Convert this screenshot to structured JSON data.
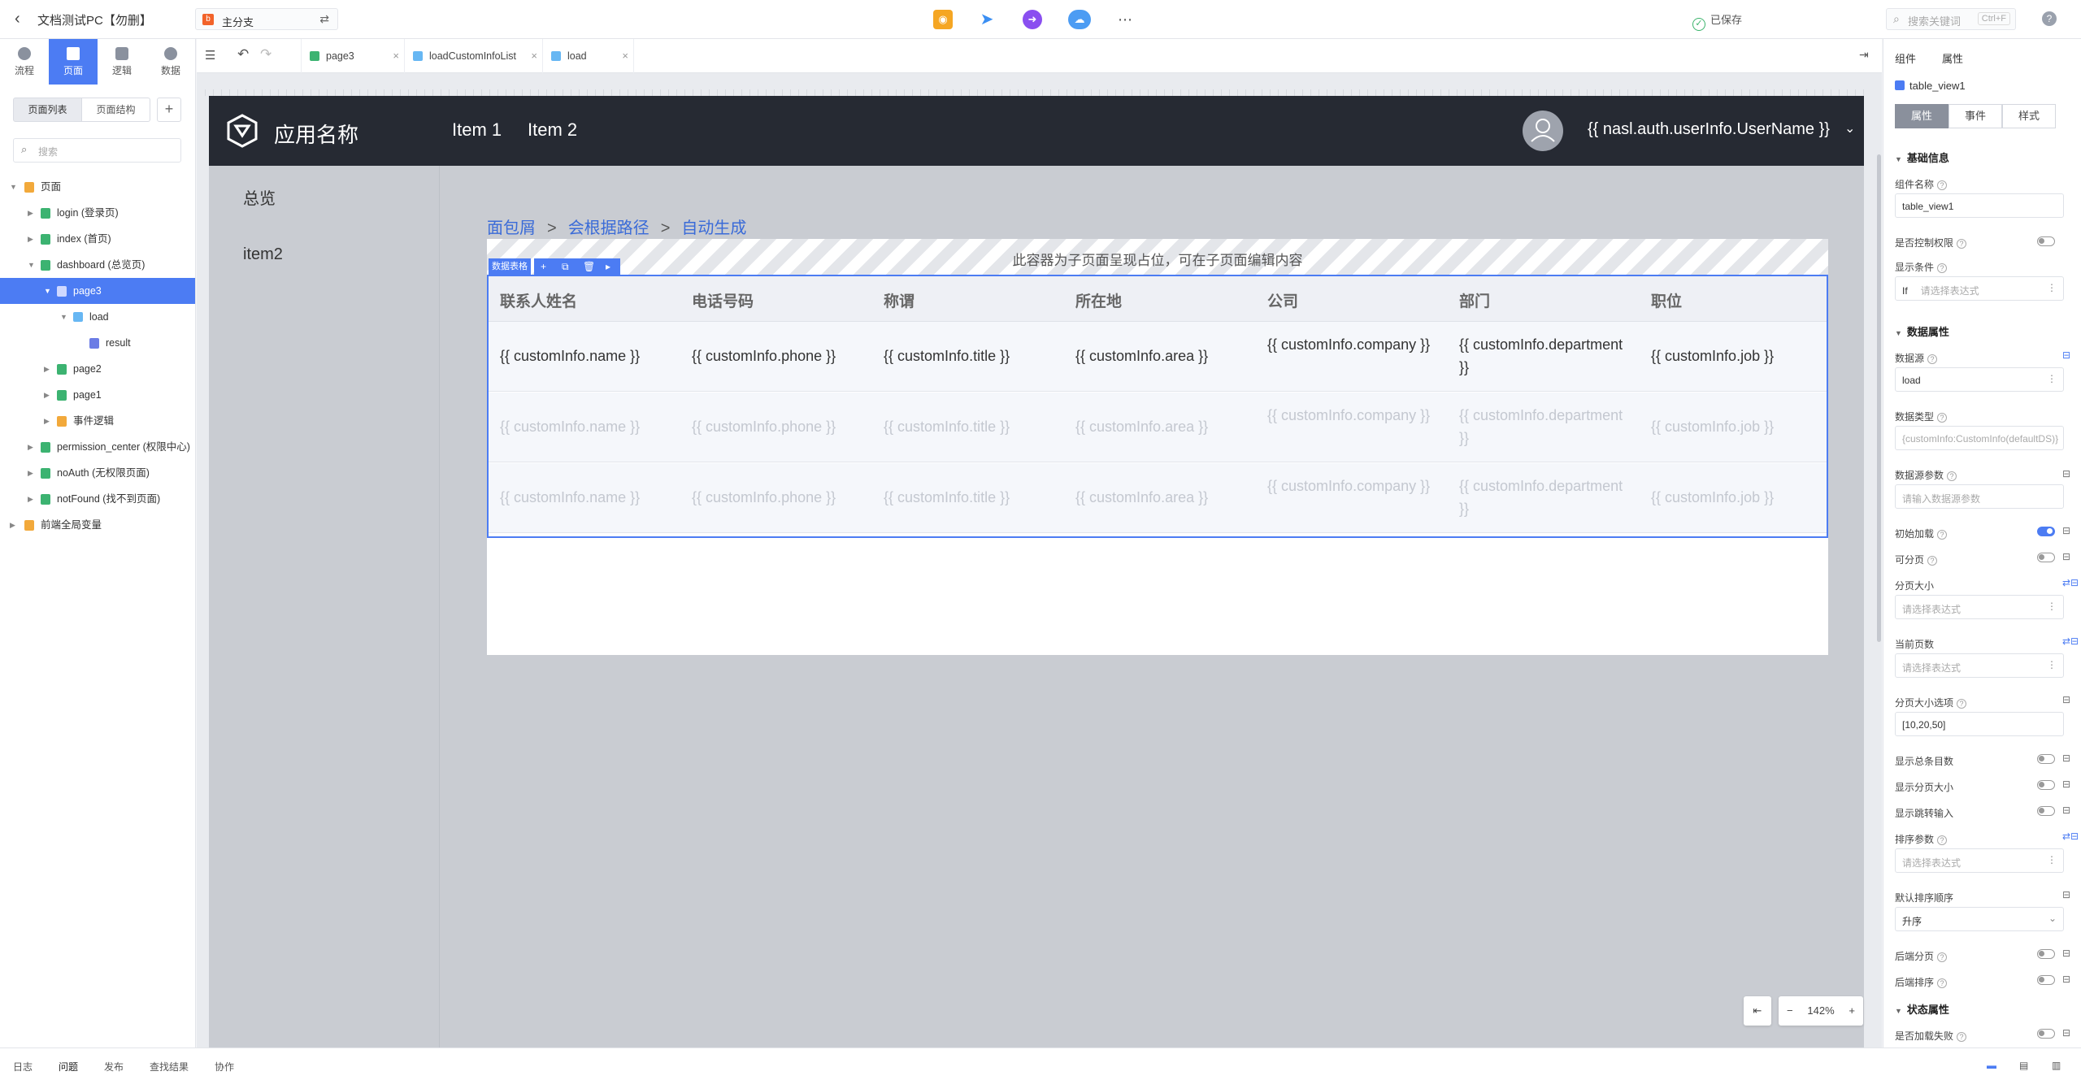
{
  "topbar": {
    "title": "文档测试PC【勿删】",
    "branch": "主分支",
    "saved": "已保存",
    "search_placeholder": "搜索关键词",
    "shortcut": "Ctrl+F",
    "icons": [
      "preview-icon",
      "publish-plane-icon",
      "share-icon",
      "cloud-icon",
      "more-icon"
    ]
  },
  "left": {
    "modes": [
      "流程",
      "页面",
      "逻辑",
      "数据"
    ],
    "seg": [
      "页面列表",
      "页面结构"
    ],
    "search_placeholder": "搜索",
    "tree": [
      {
        "label": "页面"
      },
      {
        "label": "login (登录页)"
      },
      {
        "label": "index (首页)"
      },
      {
        "label": "dashboard (总览页)"
      },
      {
        "label": "page3"
      },
      {
        "label": "load"
      },
      {
        "label": "result"
      },
      {
        "label": "page2"
      },
      {
        "label": "page1"
      },
      {
        "label": "事件逻辑"
      },
      {
        "label": "permission_center (权限中心)"
      },
      {
        "label": "noAuth (无权限页面)"
      },
      {
        "label": "notFound (找不到页面)"
      },
      {
        "label": "前端全局变量"
      }
    ]
  },
  "tabs": [
    "page3",
    "loadCustomInfoList",
    "load"
  ],
  "preview": {
    "app_name": "应用名称",
    "nav": [
      "Item 1",
      "Item 2"
    ],
    "username": "{{ nasl.auth.userInfo.UserName }}",
    "menu": [
      "总览",
      "item2"
    ],
    "breadcrumb": [
      "面包屑",
      "会根据路径",
      "自动生成"
    ],
    "placeholder_text": "此容器为子页面呈现占位，可在子页面编辑内容",
    "table_tag": "数据表格",
    "columns": [
      "联系人姓名",
      "电话号码",
      "称谓",
      "所在地",
      "公司",
      "部门",
      "职位"
    ],
    "cells": [
      "{{ customInfo.name }}",
      "{{ customInfo.phone }}",
      "{{ customInfo.title }}",
      "{{ customInfo.area }}",
      "{{ customInfo.company }}",
      "{{ customInfo.department }}",
      "{{ customInfo.job }}"
    ]
  },
  "zoom": {
    "level": "142%"
  },
  "right": {
    "tabs": [
      "组件",
      "属性"
    ],
    "component": "table_view1",
    "seg": [
      "属性",
      "事件",
      "样式"
    ],
    "basic_section": "基础信息",
    "name_label": "组件名称",
    "name_value": "table_view1",
    "perm_label": "是否控制权限",
    "cond_label": "显示条件",
    "cond_prefix": "If",
    "expr_placeholder": "请选择表达式",
    "data_section": "数据属性",
    "source_label": "数据源",
    "source_value": "load",
    "type_label": "数据类型",
    "type_value": "{customInfo:CustomInfo(defaultDS)}",
    "param_label": "数据源参数",
    "param_placeholder": "请输入数据源参数",
    "init_label": "初始加载",
    "paging_label": "可分页",
    "pagesize_label": "分页大小",
    "current_label": "当前页数",
    "options_label": "分页大小选项",
    "options_value": "[10,20,50]",
    "total_label": "显示总条目数",
    "showsize_label": "显示分页大小",
    "jump_label": "显示跳转输入",
    "sort_label": "排序参数",
    "order_label": "默认排序顺序",
    "order_value": "升序",
    "back_paging_label": "后端分页",
    "back_sort_label": "后端排序",
    "state_section": "状态属性",
    "fail_label": "是否加载失败"
  },
  "bottom": [
    "日志",
    "问题",
    "发布",
    "查找结果",
    "协作"
  ],
  "colors": {
    "accent": "#4c7cf3",
    "appbar": "#262a33"
  }
}
